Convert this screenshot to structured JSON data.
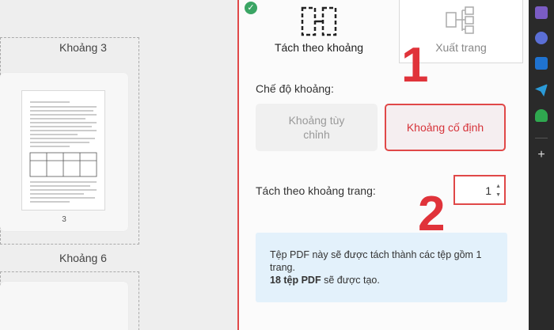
{
  "preview": {
    "group_1_label": "Khoảng 3",
    "group_2_label": "Khoảng 6",
    "page_number": "3"
  },
  "tabs": {
    "split": "Tách theo khoảng",
    "export": "Xuất trang"
  },
  "mode": {
    "title": "Chế độ khoảng:",
    "custom": "Khoảng tùy chỉnh",
    "fixed": "Khoảng cố định",
    "selected": "fixed"
  },
  "interval": {
    "label": "Tách theo khoảng trang:",
    "value": "1"
  },
  "info": {
    "line1": "Tệp PDF này sẽ được tách thành các tệp gồm 1 trang.",
    "count_strong": "18 tệp PDF",
    "count_rest": " sẽ được tạo."
  },
  "annotations": {
    "one": "1",
    "two": "2"
  },
  "colors": {
    "accent_red": "#e04848",
    "info_bg": "#e3f1fb",
    "check_green": "#3aa564"
  },
  "sidebar_icons": [
    "copilot-icon",
    "app-icon",
    "outlook-icon",
    "send-icon",
    "tree-icon",
    "plus-icon"
  ]
}
